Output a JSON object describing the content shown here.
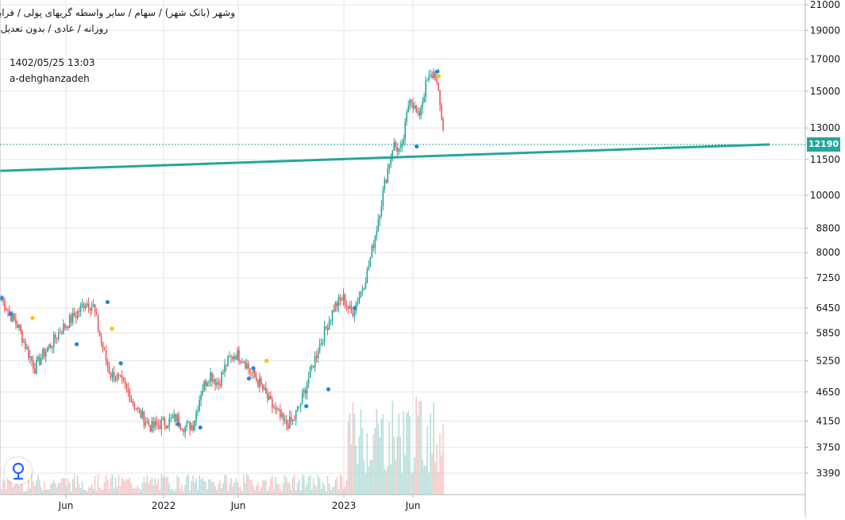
{
  "header": {
    "title": "وشهر (بانک شهر) / سهام / سایر واسطه گریهای پولی / فرابورس",
    "subtitle": "روزانه / عادی / بدون تعدیل",
    "timestamp": "1402/05/25 13:03",
    "author": "a-dehghanzadeh"
  },
  "colors": {
    "up": "#26a69a",
    "down": "#ef5350",
    "trendline": "#26a69a",
    "marker_blue": "#1e88e5",
    "marker_yellow": "#f9c400",
    "grid": "#e6e6e6"
  },
  "icons": {
    "logo": "tradingview-logo-icon"
  },
  "chart_data": {
    "type": "candlestick",
    "scale": "log",
    "y_ticks": [
      "21000",
      "19000",
      "17000",
      "15000",
      "13000",
      "11500",
      "10000",
      "8800",
      "8000",
      "7250",
      "6450",
      "5850",
      "5250",
      "4650",
      "4150",
      "3750",
      "3390"
    ],
    "x_ticks": [
      "Jun",
      "2022",
      "Jun",
      "2023",
      "Jun"
    ],
    "ylim": [
      3100,
      21500
    ],
    "grid": true,
    "last_price": 12190,
    "last_price_label": "12190",
    "close_series": [
      6700,
      6300,
      6000,
      5500,
      5100,
      5400,
      5600,
      5900,
      6100,
      6300,
      6600,
      6500,
      5600,
      5000,
      4900,
      4700,
      4400,
      4200,
      4050,
      4100,
      4150,
      4200,
      4050,
      4100,
      4700,
      5000,
      4800,
      5200,
      5400,
      5300,
      5000,
      4800,
      4500,
      4300,
      4100,
      4150,
      4500,
      5000,
      5500,
      6000,
      6500,
      6700,
      6300,
      6800,
      7500,
      8800,
      10500,
      12200,
      11800,
      14800,
      13500,
      15500,
      16200,
      13000
    ],
    "series": [
      {
        "name": "trendline",
        "start_value": 11000,
        "end_value": 12190
      }
    ],
    "markers": [
      {
        "color": "blue",
        "value": 6700
      },
      {
        "color": "blue",
        "value": 6300
      },
      {
        "color": "yellow",
        "value": 6200
      },
      {
        "color": "blue",
        "value": 5600
      },
      {
        "color": "blue",
        "value": 6600
      },
      {
        "color": "yellow",
        "value": 5950
      },
      {
        "color": "blue",
        "value": 5200
      },
      {
        "color": "blue",
        "value": 4100
      },
      {
        "color": "blue",
        "value": 4050
      },
      {
        "color": "blue",
        "value": 4900
      },
      {
        "color": "blue",
        "value": 5100
      },
      {
        "color": "yellow",
        "value": 5250
      },
      {
        "color": "blue",
        "value": 4400
      },
      {
        "color": "blue",
        "value": 4700
      },
      {
        "color": "blue",
        "value": 6450
      },
      {
        "color": "blue",
        "value": 12100
      },
      {
        "color": "blue",
        "value": 16200
      },
      {
        "color": "yellow",
        "value": 15900
      }
    ]
  }
}
